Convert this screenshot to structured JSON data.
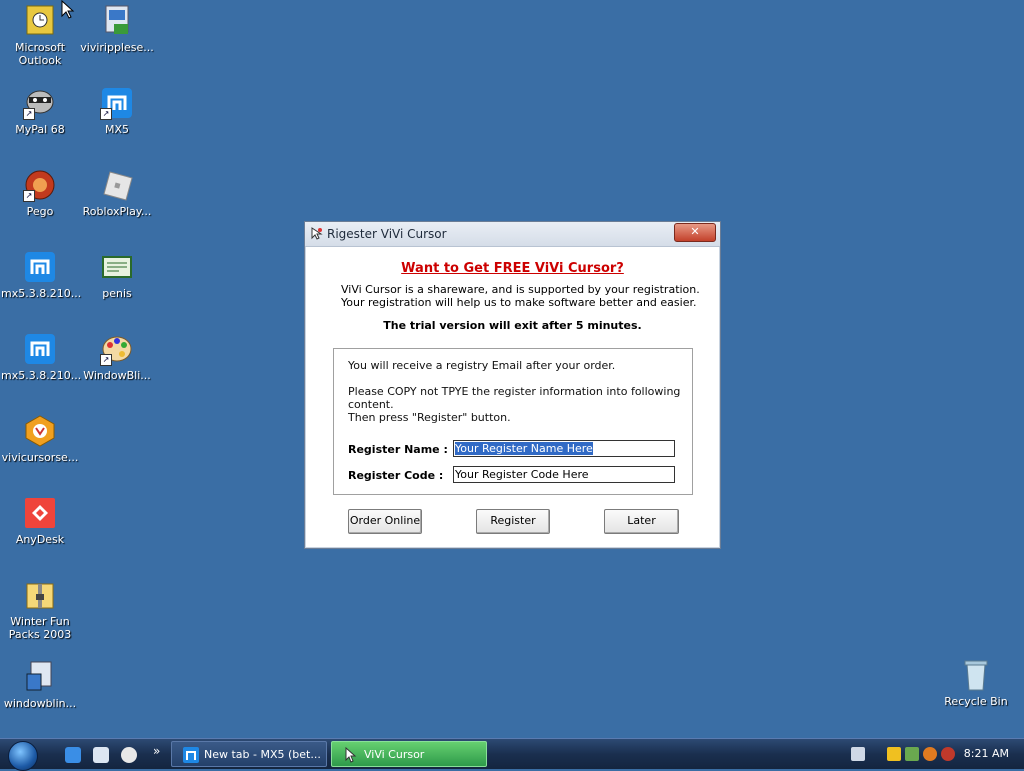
{
  "desktop": {
    "icons": [
      {
        "label": "Microsoft\nOutlook"
      },
      {
        "label": "viviripplese..."
      },
      {
        "label": "MyPal 68"
      },
      {
        "label": "MX5"
      },
      {
        "label": "Pego"
      },
      {
        "label": "RobloxPlay..."
      },
      {
        "label": "mx5.3.8.210..."
      },
      {
        "label": "penis"
      },
      {
        "label": "mx5.3.8.210..."
      },
      {
        "label": "WindowBli..."
      },
      {
        "label": "vivicursorse..."
      },
      {
        "label": "AnyDesk"
      },
      {
        "label": "Winter Fun\nPacks 2003"
      },
      {
        "label": "windowblin..."
      },
      {
        "label": "Recycle Bin"
      }
    ]
  },
  "dialog": {
    "title": "Rigester ViVi Cursor",
    "close_label": "✕",
    "headline": "Want to Get FREE ViVi Cursor?",
    "intro": "ViVi Cursor is a shareware, and is supported by your registration. Your registration will help us to make software better and easier.",
    "trial": "The trial version will exit after 5 minutes.",
    "panel": {
      "line1": "You will receive a  registry Email after your order.",
      "line2": "Please COPY not TPYE the register information into following content.",
      "line3": "Then press \"Register\" button."
    },
    "fields": {
      "name_label": "Register Name :",
      "name_value": "Your Register Name Here",
      "code_label": "Register Code :",
      "code_value": "Your Register Code Here"
    },
    "buttons": {
      "order_online": "Order Online",
      "register": "Register",
      "later": "Later"
    }
  },
  "taskbar": {
    "chevron": "»",
    "tasks": [
      {
        "label": "New tab - MX5 (bet..."
      },
      {
        "label": "ViVi Cursor"
      }
    ],
    "clock": "8:21 AM"
  },
  "colors": {
    "desktop_bg": "#3a6ea5",
    "headline": "#cc0000",
    "selection": "#316ac5"
  }
}
